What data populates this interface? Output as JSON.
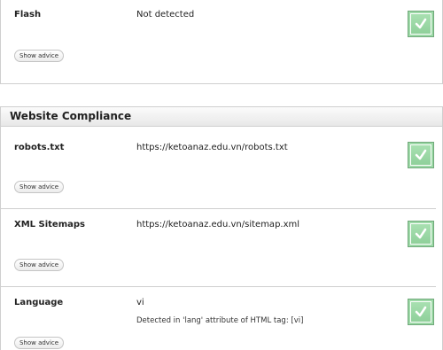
{
  "flash": {
    "label": "Flash",
    "value": "Not detected",
    "advice": "Show advice",
    "status_icon": "check-icon"
  },
  "compliance": {
    "header": "Website Compliance",
    "rows": [
      {
        "label": "robots.txt",
        "value": "https://ketoanaz.edu.vn/robots.txt",
        "note": "",
        "advice": "Show advice",
        "status_icon": "check-icon"
      },
      {
        "label": "XML Sitemaps",
        "value": "https://ketoanaz.edu.vn/sitemap.xml",
        "note": "",
        "advice": "Show advice",
        "status_icon": "check-icon"
      },
      {
        "label": "Language",
        "value": "vi",
        "note": "Detected in 'lang' attribute of HTML tag: [vi]",
        "advice": "Show advice",
        "status_icon": "check-icon"
      }
    ]
  },
  "colors": {
    "check_bg": "#9dd9a7",
    "check_border": "#6fa879",
    "divider": "#cfcfcf"
  }
}
